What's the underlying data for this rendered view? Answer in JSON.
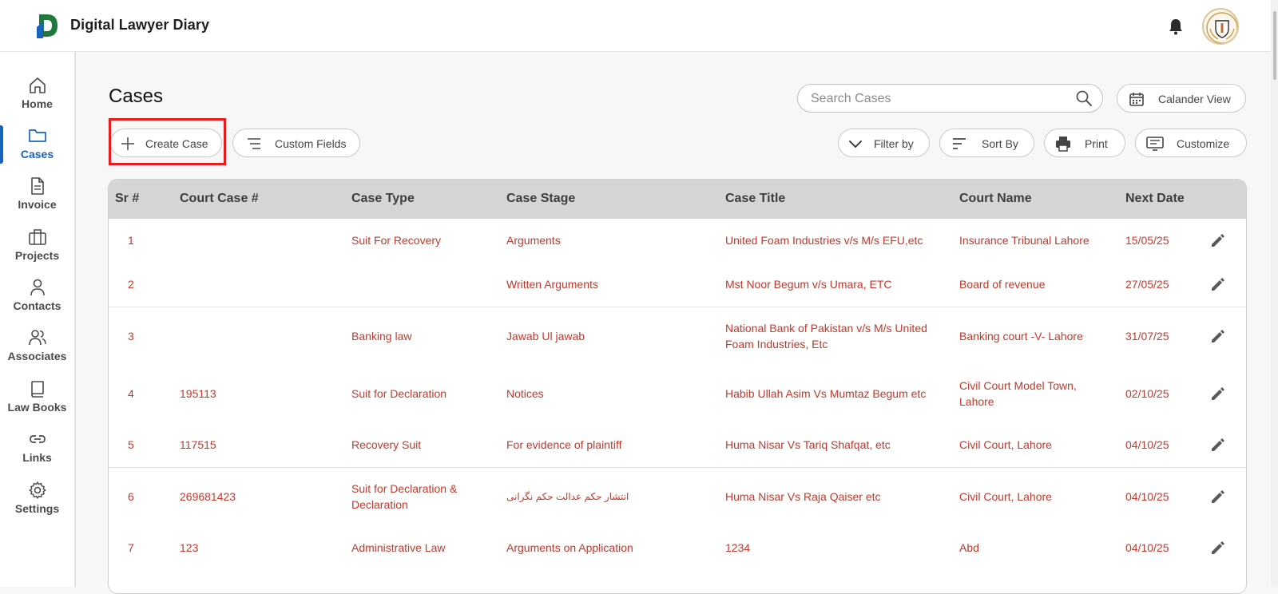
{
  "app": {
    "title": "Digital Lawyer Diary"
  },
  "sidebar": {
    "items": [
      {
        "label": "Home",
        "icon": "home-icon"
      },
      {
        "label": "Cases",
        "icon": "folder-icon",
        "active": true
      },
      {
        "label": "Invoice",
        "icon": "document-icon"
      },
      {
        "label": "Projects",
        "icon": "briefcase-icon"
      },
      {
        "label": "Contacts",
        "icon": "person-icon"
      },
      {
        "label": "Associates",
        "icon": "people-icon"
      },
      {
        "label": "Law Books",
        "icon": "book-icon"
      },
      {
        "label": "Links",
        "icon": "link-icon"
      },
      {
        "label": "Settings",
        "icon": "gear-icon"
      }
    ]
  },
  "main": {
    "title": "Cases",
    "search": {
      "placeholder": "Search Cases"
    },
    "buttons": {
      "calendar_view": "Calander View",
      "create_case": "Create Case",
      "custom_fields": "Custom Fields",
      "filter_by": "Filter by",
      "sort_by": "Sort By",
      "print": "Print",
      "customize": "Customize"
    }
  },
  "table": {
    "columns": [
      "Sr #",
      "Court Case #",
      "Case Type",
      "Case Stage",
      "Case Title",
      "Court Name",
      "Next Date"
    ],
    "rows": [
      {
        "sr": "1",
        "court_case": "",
        "case_type": "Suit For Recovery",
        "case_stage": "Arguments",
        "case_title": "United Foam Industries v/s M/s EFU,etc",
        "court_name": "Insurance Tribunal Lahore",
        "next_date": "15/05/25"
      },
      {
        "sr": "2",
        "court_case": "",
        "case_type": "",
        "case_stage": "Written Arguments",
        "case_title": "Mst Noor Begum v/s Umara, ETC",
        "court_name": "Board of revenue",
        "next_date": "27/05/25"
      },
      {
        "sr": "3",
        "court_case": "",
        "case_type": "Banking law",
        "case_stage": "Jawab Ul jawab",
        "case_title": "National Bank of Pakistan v/s M/s United Foam Industries, Etc",
        "court_name": "Banking court -V- Lahore",
        "next_date": "31/07/25"
      },
      {
        "sr": "4",
        "court_case": "195113",
        "case_type": "Suit for Declaration",
        "case_stage": "Notices",
        "case_title": "Habib Ullah Asim Vs Mumtaz Begum etc",
        "court_name": "Civil Court Model Town, Lahore",
        "next_date": "02/10/25"
      },
      {
        "sr": "5",
        "court_case": "117515",
        "case_type": "Recovery Suit",
        "case_stage": "For evidence of plaintiff",
        "case_title": "Huma Nisar Vs Tariq Shafqat, etc",
        "court_name": "Civil Court, Lahore",
        "next_date": "04/10/25"
      },
      {
        "sr": "6",
        "court_case": "269681423",
        "case_type": "Suit for Declaration & Declaration",
        "case_stage": "انتشار حکم عدالت حکم نگرانی",
        "case_title": "Huma Nisar Vs Raja Qaiser etc",
        "court_name": "Civil Court, Lahore",
        "next_date": "04/10/25"
      },
      {
        "sr": "7",
        "court_case": "123",
        "case_type": "Administrative Law",
        "case_stage": "Arguments on Application",
        "case_title": "1234",
        "court_name": "Abd",
        "next_date": "04/10/25"
      }
    ]
  },
  "colors": {
    "accent": "#1565c0",
    "row_text": "#c0392b",
    "highlight": "#e51d1d",
    "header_bg": "#d6d4d4"
  }
}
